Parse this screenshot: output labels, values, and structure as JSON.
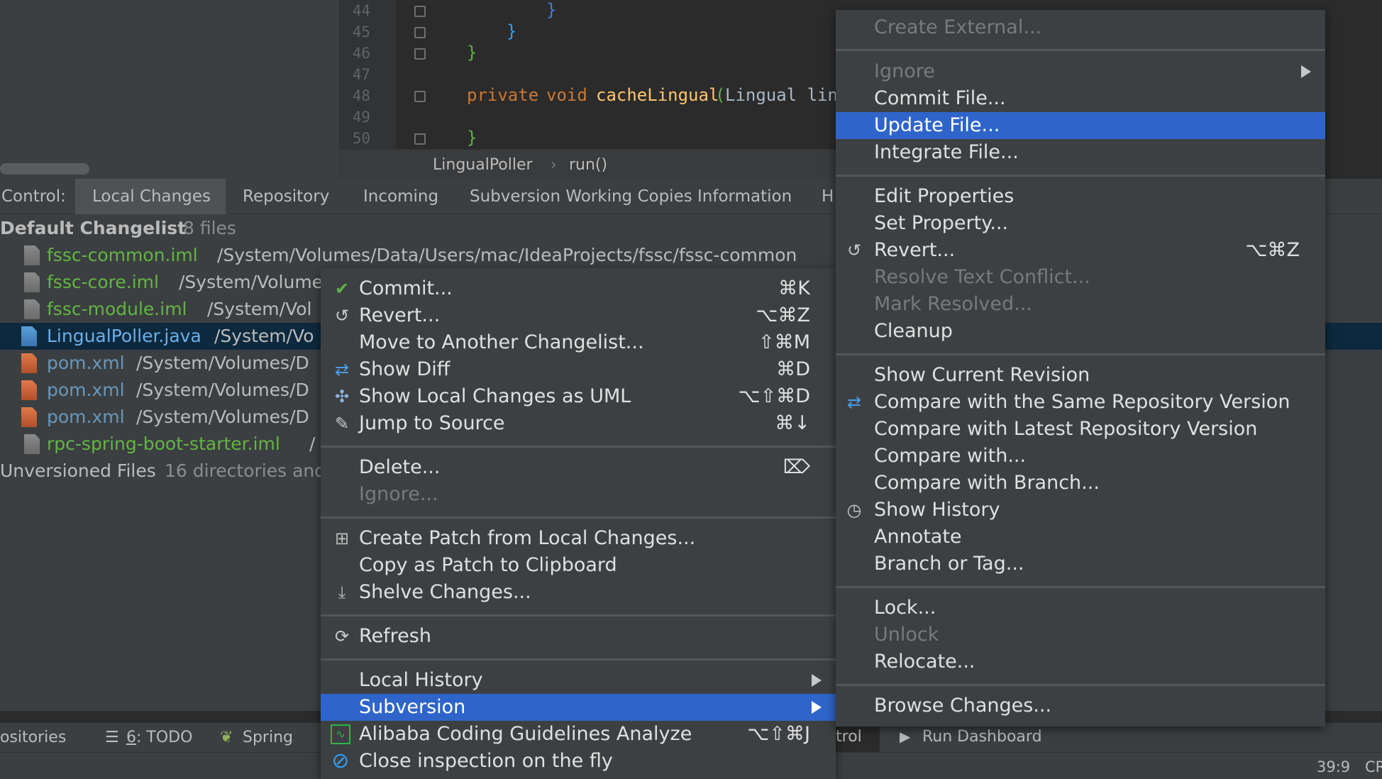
{
  "editor": {
    "line_numbers": [
      "44",
      "45",
      "46",
      "47",
      "48",
      "49",
      "50"
    ],
    "code": {
      "brace_44": "}",
      "brace_45": "}",
      "brace_46": "}",
      "kw_private": "private",
      "kw_void": "void",
      "method_name": "cacheLingual",
      "paren_open": "(",
      "param": "Lingual lin",
      "brace_50": "}"
    },
    "breadcrumb": {
      "class": "LingualPoller",
      "separator": "›",
      "method": "run()"
    }
  },
  "tool_window": {
    "title": "Control:",
    "tabs": [
      "Local Changes",
      "Repository",
      "Incoming",
      "Subversion Working Copies Information",
      "H"
    ]
  },
  "changes": {
    "default_changelist": {
      "name": "Default Changelist",
      "count": "8 files"
    },
    "files": [
      {
        "name": "fssc-common.iml",
        "path": "/System/Volumes/Data/Users/mac/IdeaProjects/fssc/fssc-common"
      },
      {
        "name": "fssc-core.iml",
        "path": "/System/Volume"
      },
      {
        "name": "fssc-module.iml",
        "path": "/System/Vol"
      },
      {
        "name": "LingualPoller.java",
        "path": "/System/Vo"
      },
      {
        "name": "pom.xml",
        "path": "/System/Volumes/D"
      },
      {
        "name": "pom.xml",
        "path": "/System/Volumes/D"
      },
      {
        "name": "pom.xml",
        "path": "/System/Volumes/D"
      },
      {
        "name": "rpc-spring-boot-starter.iml",
        "path": "/"
      }
    ],
    "unversioned": {
      "name": "Unversioned Files",
      "desc": "16 directories and"
    }
  },
  "context_menu": {
    "commit": {
      "label": "Commit...",
      "shortcut": "⌘K"
    },
    "revert": {
      "label": "Revert...",
      "shortcut": "⌥⌘Z"
    },
    "move": {
      "label": "Move to Another Changelist...",
      "shortcut": "⇧⌘M"
    },
    "show_diff": {
      "label": "Show Diff",
      "shortcut": "⌘D"
    },
    "uml": {
      "label": "Show Local Changes as UML",
      "shortcut": "⌥⇧⌘D"
    },
    "jump": {
      "label": "Jump to Source",
      "shortcut": "⌘↓"
    },
    "delete": {
      "label": "Delete...",
      "shortcut": "⌦"
    },
    "ignore": {
      "label": "Ignore..."
    },
    "create_patch": {
      "label": "Create Patch from Local Changes..."
    },
    "copy_patch": {
      "label": "Copy as Patch to Clipboard"
    },
    "shelve": {
      "label": "Shelve Changes..."
    },
    "refresh": {
      "label": "Refresh"
    },
    "local_history": {
      "label": "Local History"
    },
    "subversion": {
      "label": "Subversion"
    },
    "alibaba": {
      "label": "Alibaba Coding Guidelines Analyze",
      "shortcut": "⌥⇧⌘J"
    },
    "close_inspection": {
      "label": "Close inspection on the fly"
    }
  },
  "svn_menu": {
    "create_external": "Create External...",
    "ignore": "Ignore",
    "commit_file": "Commit File...",
    "update_file": "Update File...",
    "integrate_file": "Integrate File...",
    "edit_properties": "Edit Properties",
    "set_property": "Set Property...",
    "revert": {
      "label": "Revert...",
      "shortcut": "⌥⌘Z"
    },
    "resolve_conflict": "Resolve Text Conflict...",
    "mark_resolved": "Mark Resolved...",
    "cleanup": "Cleanup",
    "show_current_revision": "Show Current Revision",
    "compare_same": "Compare with the Same Repository Version",
    "compare_latest": "Compare with Latest Repository Version",
    "compare_with": "Compare with...",
    "compare_branch": "Compare with Branch...",
    "show_history": "Show History",
    "annotate": "Annotate",
    "branch_tag": "Branch or Tag...",
    "lock": "Lock...",
    "unlock": "Unlock",
    "relocate": "Relocate...",
    "browse_changes": "Browse Changes..."
  },
  "bottom_bar": {
    "repositories": "ositories",
    "todo_num": "6",
    "todo_label": ": TODO",
    "spring": "Spring",
    "control": "trol",
    "run_dashboard": "Run Dashboard"
  },
  "status_bar": {
    "position": "39:9",
    "extra": "CR"
  },
  "colors": {
    "highlight": "#2f65ca",
    "file_green": "#62b543",
    "file_blue": "#6897bb",
    "selection_row": "#0d293e"
  }
}
